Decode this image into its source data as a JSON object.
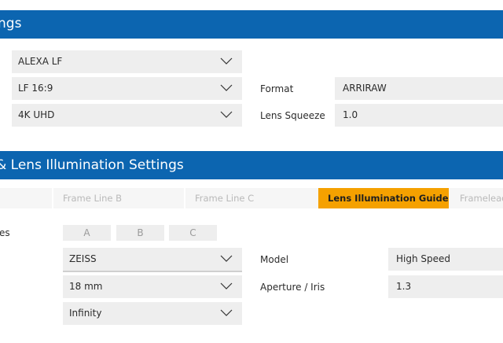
{
  "camera_section": {
    "title": "Camera Settings",
    "fragment": "ngs",
    "selects": [
      {
        "value": "ALEXA LF"
      },
      {
        "value": "LF 16:9"
      },
      {
        "value": "4K UHD"
      }
    ],
    "format": {
      "label": "Format",
      "value": "ARRIRAW"
    },
    "lens_squeeze": {
      "label": "Lens Squeeze",
      "value": "1.0"
    }
  },
  "lens_section": {
    "title": "& Lens Illumination Settings",
    "fragment": "& Lens Illumination Settings",
    "tabs": [
      {
        "label": "Frame Line B",
        "active": false
      },
      {
        "label": "Frame Line C",
        "active": false
      },
      {
        "label": "Lens Illumination Guide",
        "active": true
      },
      {
        "label": "Framelead",
        "active": false
      }
    ],
    "lines_label_fragment": "es",
    "line_buttons": [
      "A",
      "B",
      "C"
    ],
    "selects": [
      {
        "value": "ZEISS"
      },
      {
        "value": "18 mm"
      },
      {
        "value": "Infinity"
      }
    ],
    "model": {
      "label": "Model",
      "value": "High Speed"
    },
    "aperture": {
      "label": "Aperture / Iris",
      "value": "1.3"
    }
  },
  "colors": {
    "header_blue": "#0c65b0",
    "active_tab": "#f5a100",
    "field_bg": "#eeeeee"
  },
  "icons": {
    "dropdown": "chevron-down-icon"
  }
}
